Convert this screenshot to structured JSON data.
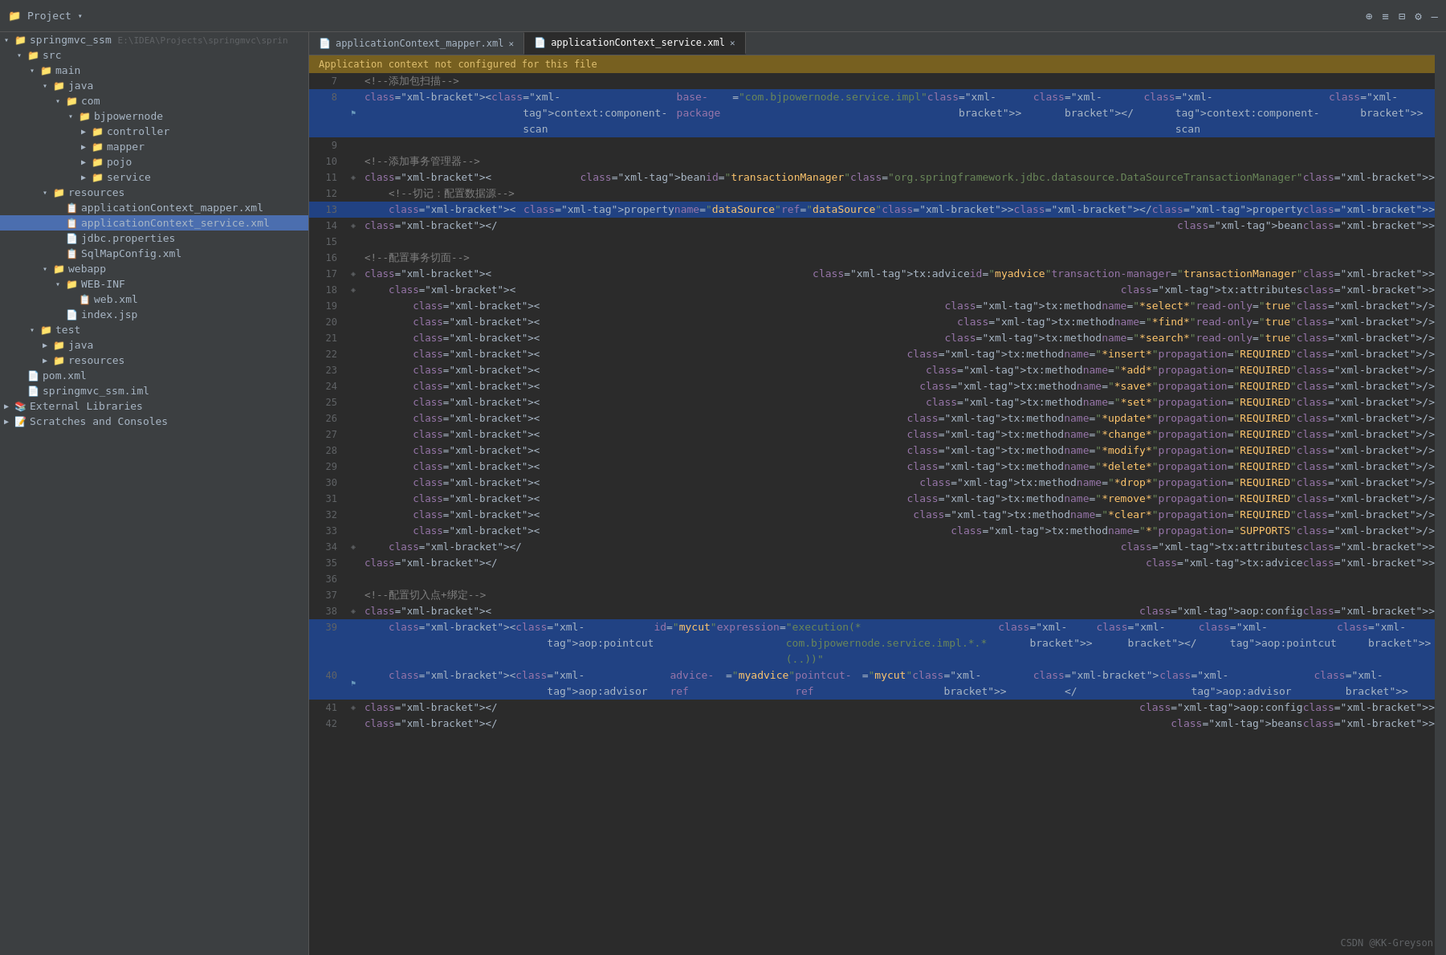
{
  "titleBar": {
    "projectLabel": "Project",
    "icons": [
      "⊕",
      "≡",
      "⊟",
      "⚙",
      "—"
    ]
  },
  "tabs": [
    {
      "id": "tab-mapper",
      "label": "applicationContext_mapper.xml",
      "active": false,
      "icon": "📄"
    },
    {
      "id": "tab-service",
      "label": "applicationContext_service.xml",
      "active": true,
      "icon": "📄"
    }
  ],
  "warningBar": {
    "text": "Application context not configured for this file"
  },
  "sidebar": {
    "projectTitle": "springmvc_ssm",
    "projectPath": "E:\\IDEA\\Projects\\springmvc\\sprin",
    "tree": [
      {
        "level": 0,
        "type": "folder",
        "label": "springmvc_ssm",
        "extra": "E:\\IDEA\\Projects\\springmvc\\sprin",
        "expanded": true,
        "arrow": "▾"
      },
      {
        "level": 1,
        "type": "folder",
        "label": "src",
        "expanded": true,
        "arrow": "▾"
      },
      {
        "level": 2,
        "type": "folder",
        "label": "main",
        "expanded": true,
        "arrow": "▾"
      },
      {
        "level": 3,
        "type": "folder-blue",
        "label": "java",
        "expanded": true,
        "arrow": "▾"
      },
      {
        "level": 4,
        "type": "folder",
        "label": "com",
        "expanded": true,
        "arrow": "▾"
      },
      {
        "level": 5,
        "type": "folder",
        "label": "bjpowernode",
        "expanded": true,
        "arrow": "▾"
      },
      {
        "level": 6,
        "type": "folder",
        "label": "controller",
        "expanded": false,
        "arrow": "▶"
      },
      {
        "level": 6,
        "type": "folder",
        "label": "mapper",
        "expanded": false,
        "arrow": "▶"
      },
      {
        "level": 6,
        "type": "folder",
        "label": "pojo",
        "expanded": false,
        "arrow": "▶"
      },
      {
        "level": 6,
        "type": "folder",
        "label": "service",
        "expanded": false,
        "arrow": "▶"
      },
      {
        "level": 3,
        "type": "folder-res",
        "label": "resources",
        "expanded": true,
        "arrow": "▾"
      },
      {
        "level": 4,
        "type": "file-xml",
        "label": "applicationContext_mapper.xml",
        "selected": false
      },
      {
        "level": 4,
        "type": "file-xml",
        "label": "applicationContext_service.xml",
        "selected": true
      },
      {
        "level": 4,
        "type": "file-prop",
        "label": "jdbc.properties"
      },
      {
        "level": 4,
        "type": "file-xml",
        "label": "SqlMapConfig.xml"
      },
      {
        "level": 3,
        "type": "folder",
        "label": "webapp",
        "expanded": true,
        "arrow": "▾"
      },
      {
        "level": 4,
        "type": "folder",
        "label": "WEB-INF",
        "expanded": true,
        "arrow": "▾"
      },
      {
        "level": 5,
        "type": "file-xml",
        "label": "web.xml"
      },
      {
        "level": 4,
        "type": "file-jsp",
        "label": "index.jsp"
      },
      {
        "level": 2,
        "type": "folder",
        "label": "test",
        "expanded": true,
        "arrow": "▾"
      },
      {
        "level": 3,
        "type": "folder-blue",
        "label": "java",
        "expanded": false,
        "arrow": "▶"
      },
      {
        "level": 3,
        "type": "folder-res",
        "label": "resources",
        "expanded": false,
        "arrow": "▶"
      },
      {
        "level": 1,
        "type": "file-pom",
        "label": "pom.xml"
      },
      {
        "level": 1,
        "type": "file-iml",
        "label": "springmvc_ssm.iml"
      },
      {
        "level": 0,
        "type": "ext-lib",
        "label": "External Libraries",
        "expanded": false,
        "arrow": "▶"
      },
      {
        "level": 0,
        "type": "scratch",
        "label": "Scratches and Consoles",
        "expanded": false,
        "arrow": "▶"
      }
    ]
  },
  "codeLines": [
    {
      "num": 7,
      "gutter": "",
      "content": "<!--添加包扫描-->",
      "highlight": false
    },
    {
      "num": 8,
      "gutter": "⚑",
      "content": "<context:component-scan base-package=\"com.bjpowernode.service.impl\"></context:component-scan>",
      "highlight": true
    },
    {
      "num": 9,
      "gutter": "",
      "content": "",
      "highlight": false
    },
    {
      "num": 10,
      "gutter": "",
      "content": "<!--添加事务管理器-->",
      "highlight": false
    },
    {
      "num": 11,
      "gutter": "◈",
      "content": "<bean id=\"transactionManager\" class=\"org.springframework.jdbc.datasource.DataSourceTransactionManager\">",
      "highlight": false
    },
    {
      "num": 12,
      "gutter": "",
      "content": "    <!--切记：配置数据源-->",
      "highlight": false
    },
    {
      "num": 13,
      "gutter": "",
      "content": "    <property name=\"dataSource\" ref=\"dataSource\"></property>",
      "highlight": true
    },
    {
      "num": 14,
      "gutter": "◈",
      "content": "</bean>",
      "highlight": false
    },
    {
      "num": 15,
      "gutter": "",
      "content": "",
      "highlight": false
    },
    {
      "num": 16,
      "gutter": "",
      "content": "<!--配置事务切面-->",
      "highlight": false
    },
    {
      "num": 17,
      "gutter": "◈",
      "content": "<tx:advice id=\"myadvice\" transaction-manager=\"transactionManager\">",
      "highlight": false
    },
    {
      "num": 18,
      "gutter": "◈",
      "content": "    <tx:attributes>",
      "highlight": false
    },
    {
      "num": 19,
      "gutter": "",
      "content": "        <tx:method name=\"*select*\" read-only=\"true\"/>",
      "highlight": false
    },
    {
      "num": 20,
      "gutter": "",
      "content": "        <tx:method name=\"*find*\" read-only=\"true\"/>",
      "highlight": false
    },
    {
      "num": 21,
      "gutter": "",
      "content": "        <tx:method name=\"*search*\" read-only=\"true\"/>",
      "highlight": false
    },
    {
      "num": 22,
      "gutter": "",
      "content": "        <tx:method name=\"*insert*\" propagation=\"REQUIRED\"/>",
      "highlight": false
    },
    {
      "num": 23,
      "gutter": "",
      "content": "        <tx:method name=\"*add*\" propagation=\"REQUIRED\"/>",
      "highlight": false
    },
    {
      "num": 24,
      "gutter": "",
      "content": "        <tx:method name=\"*save*\" propagation=\"REQUIRED\"/>",
      "highlight": false
    },
    {
      "num": 25,
      "gutter": "",
      "content": "        <tx:method name=\"*set*\" propagation=\"REQUIRED\"/>",
      "highlight": false
    },
    {
      "num": 26,
      "gutter": "",
      "content": "        <tx:method name=\"*update*\" propagation=\"REQUIRED\"/>",
      "highlight": false
    },
    {
      "num": 27,
      "gutter": "",
      "content": "        <tx:method name=\"*change*\" propagation=\"REQUIRED\"/>",
      "highlight": false
    },
    {
      "num": 28,
      "gutter": "",
      "content": "        <tx:method name=\"*modify*\" propagation=\"REQUIRED\"/>",
      "highlight": false
    },
    {
      "num": 29,
      "gutter": "",
      "content": "        <tx:method name=\"*delete*\" propagation=\"REQUIRED\"/>",
      "highlight": false
    },
    {
      "num": 30,
      "gutter": "",
      "content": "        <tx:method name=\"*drop*\" propagation=\"REQUIRED\"/>",
      "highlight": false
    },
    {
      "num": 31,
      "gutter": "",
      "content": "        <tx:method name=\"*remove*\" propagation=\"REQUIRED\"/>",
      "highlight": false
    },
    {
      "num": 32,
      "gutter": "",
      "content": "        <tx:method name=\"*clear*\" propagation=\"REQUIRED\"/>",
      "highlight": false
    },
    {
      "num": 33,
      "gutter": "",
      "content": "        <tx:method name=\"*\" propagation=\"SUPPORTS\"/>",
      "highlight": false
    },
    {
      "num": 34,
      "gutter": "◈",
      "content": "    </tx:attributes>",
      "highlight": false
    },
    {
      "num": 35,
      "gutter": "",
      "content": "</tx:advice>",
      "highlight": false
    },
    {
      "num": 36,
      "gutter": "",
      "content": "",
      "highlight": false
    },
    {
      "num": 37,
      "gutter": "",
      "content": "<!--配置切入点+绑定-->",
      "highlight": false
    },
    {
      "num": 38,
      "gutter": "◈",
      "content": "<aop:config>",
      "highlight": false
    },
    {
      "num": 39,
      "gutter": "",
      "content": "    <aop:pointcut id=\"mycut\" expression=\"execution(* com.bjpowernode.service.impl.*.*(..))\"></aop:pointcut>",
      "highlight": true
    },
    {
      "num": 40,
      "gutter": "⚑",
      "content": "    <aop:advisor advice-ref=\"myadvice\" pointcut-ref=\"mycut\" ></aop:advisor>",
      "highlight": true
    },
    {
      "num": 41,
      "gutter": "◈",
      "content": "</aop:config>",
      "highlight": false
    },
    {
      "num": 42,
      "gutter": "",
      "content": "</beans>",
      "highlight": false
    }
  ],
  "watermark": "CSDN @KK-Greyson"
}
